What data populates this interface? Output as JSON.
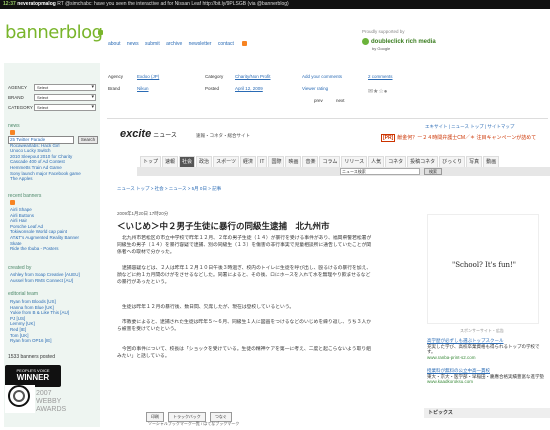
{
  "ticker": {
    "time": "12:37",
    "user": "neveratopmalog",
    "text": "RT @simchabc: have you seen the interactive ad for Nissan Leaf http://bit.ly/9PLSGB (via @bannerblog)"
  },
  "brand": {
    "name": "bannerblog",
    "color": "#79b52b"
  },
  "topnav": [
    "about",
    "news",
    "submit",
    "archive",
    "newsletter",
    "contact"
  ],
  "sponsor": {
    "label": "Proudly supported by",
    "name": "doubleclick rich media",
    "tagline": "by Google"
  },
  "sidebar": {
    "search_button": "Search",
    "filters": [
      {
        "label": "AGENCY",
        "value": "Select"
      },
      {
        "label": "BRAND",
        "value": "Select"
      },
      {
        "label": "CATEGORY",
        "value": "Select"
      }
    ],
    "news_title": "news",
    "news_items": [
      "25 Twitter Parade",
      "Rocawearlabs: Hack Girl",
      "Unoco Lucky Switch",
      "2010 Sleepout 2010 for Charity",
      "Cascade 400 of Ad Contest",
      "Hemmetts Train Ad Game",
      "Sony launch major Facebook game",
      "The Apples"
    ],
    "recent_title": "recent banners",
    "recent_items": [
      "Airli Shape",
      "Airli Buttons",
      "Airli Hair",
      "Porsche Leaf Ad",
      "Tokiwonsole World cap paint",
      "AT&T's Augmented Reality Banner",
      "Skate",
      "Ride the Ibuba - Posters"
    ],
    "created_title": "created by",
    "created_items": [
      "Ashley from Soap Creative [AUEU]",
      "Aussel from RMS Connect [AU]"
    ],
    "team_title": "editorial team",
    "team_items": [
      "Ryan from Bloods [US]",
      "Hanna from Blue [UK]",
      "Yukie from B & Like This [AU]",
      "PJ [US]",
      "Lemmy [UK]",
      "Red [IE]",
      "Tom [UK]",
      "Ryan from OP16 [IE]"
    ],
    "count_text": "1533 banners posted",
    "award": {
      "line1": "PEOPLE'S VOICE",
      "line2": "WINNER",
      "year": "2007",
      "name": "WEBBY",
      "sub": "AWARDS"
    }
  },
  "meta": {
    "agency_label": "Agency",
    "agency_value": "Exdoo (JP)",
    "brand_label": "Brand",
    "brand_value": "Nikun",
    "category_label": "Category",
    "category_value": "Charity/Non Profit",
    "posted_label": "Posted",
    "posted_value": "April 12, 2009",
    "add_comments": "Add your comments",
    "comments_count": "2 comments",
    "voting_label": "Viewer rating",
    "prev": "prev",
    "next": "next"
  },
  "excite": {
    "logo": "excite",
    "logo_suffix": "ニュース",
    "tagline": "速報・コネタ・総合サイト",
    "top_links": "エキサイト | ニュース トップ | サイトマップ",
    "banner_tag": "[PR]",
    "banner_text": "献金何？ー２４時間弁護士CM／＊ 注目キャンペーンが詰めて",
    "categories": [
      "トップ",
      "速報",
      "社会",
      "政治",
      "スポーツ",
      "経済",
      "IT",
      "国際",
      "映画",
      "音楽",
      "コラム",
      "リリース",
      "人気",
      "コネタ",
      "投稿コネタ",
      "びっくり",
      "写真",
      "動画"
    ],
    "search_placeholder": "ニュース検索",
    "search_button": "検索",
    "breadcrumb": "ニュース トップ > 社会 > ニュース > 5月 0日 > 記事"
  },
  "article": {
    "date": "2009年1月20日 17時20分",
    "headline": "＜いじめ＞中２男子生徒に暴行の同級生逮捕　北九州市",
    "paragraphs": [
      "北九州市若松区の市立中学校で昨年１２月、２年の男子生徒（１４）が暴行を受ける事件があり、福岡県警若松署が同級生の男子（１４）を暴行容疑で逮捕、別の同級生（１３）を傷害の非行事実で児童相談所に通告していたことが関係者への取材で分かった。",
      "逮捕容疑などは、２人は昨年１２月１０日午後３時過ぎ、校内のトイレに生徒を呼び出し、殴るけるの暴行を加え、顔などに約１カ月間のけがをさせるなどした。同署によると、その後、ロにホースを入れて水を無理やり飲ませるなどの暴行があったという。",
      "生徒は昨年１２月の暴行後、数日間、欠席したが、現在は登校しているという。",
      "市教委によると、逮捕された生徒は昨年５～６月、同級生１人に図画をつけるなどのいじめを繰り返し、うち３人から被害を受けていたという。",
      "今回の事件について、校長は「ショックを受けている。生徒の精神ケアを第一に考え、二度と起こらないよう取り組みたい」と話している。"
    ],
    "buttons": [
      "印刷",
      "トラックバック",
      "つなぐ"
    ],
    "social_text": "ソーシャルブックマーク一覧 / はてなブックマーク"
  },
  "right_col": {
    "poster_text": "\"School? It's fun!\"",
    "ads_label": "スポンサーサイト・広告",
    "ads": [
      {
        "title": "高学歴が必ずしも選ぶトップスクール",
        "desc": "充実した学び、高校卒業資格も得られるトップの学校です。",
        "url": "www.ranba-print-s2.com"
      },
      {
        "title": "授業料が無料の公立中高一貫校",
        "desc": "東大・京大・医学部・早稲田・慶應合格実績豊富な進学塾",
        "url": "www.kaadkoroksu.com"
      }
    ],
    "topics_label": "トピックス"
  }
}
